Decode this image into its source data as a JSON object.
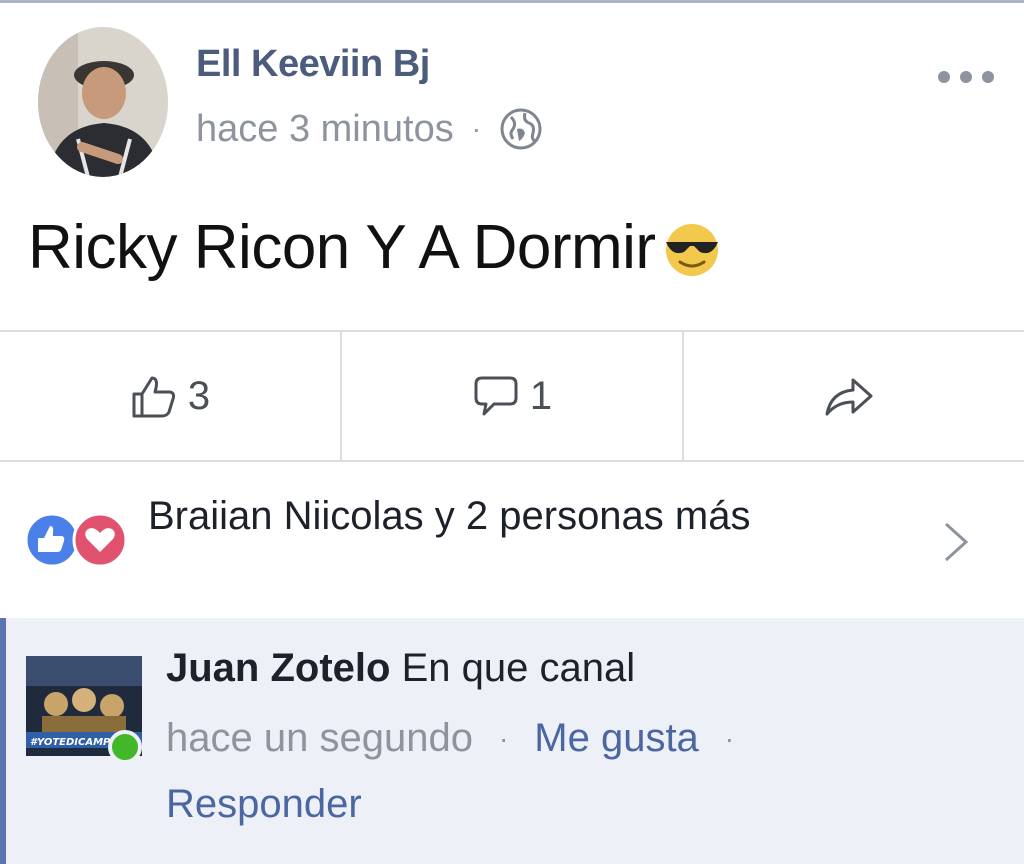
{
  "post": {
    "author": "Ell Keeviin Bj",
    "timestamp": "hace 3 minutos",
    "separator": "·",
    "privacy_icon": "globe-icon",
    "text": "Ricky Ricon Y A Dormir",
    "emoji": "sunglasses-smiley-emoji"
  },
  "actions": {
    "like_count": "3",
    "comment_count": "1",
    "share_icon": "share-arrow-icon"
  },
  "reactions": {
    "summary": "Braiian Niicolas y 2 personas más",
    "icons": [
      "like-reaction-icon",
      "love-reaction-icon"
    ],
    "colors": {
      "like": "#4a80e8",
      "love": "#e0526d"
    }
  },
  "comment": {
    "author": "Juan Zotelo",
    "text": "En que canal",
    "timestamp": "hace un segundo",
    "separator": "·",
    "like_label": "Me gusta",
    "reply_label": "Responder",
    "avatar_caption": "#YOTEDICAMPEÓN",
    "online_color": "#42b72a"
  },
  "colors": {
    "link": "#4b67a1",
    "author_name": "#4b5c7d",
    "muted": "#8d949e",
    "comment_bg": "#edf0f7"
  }
}
